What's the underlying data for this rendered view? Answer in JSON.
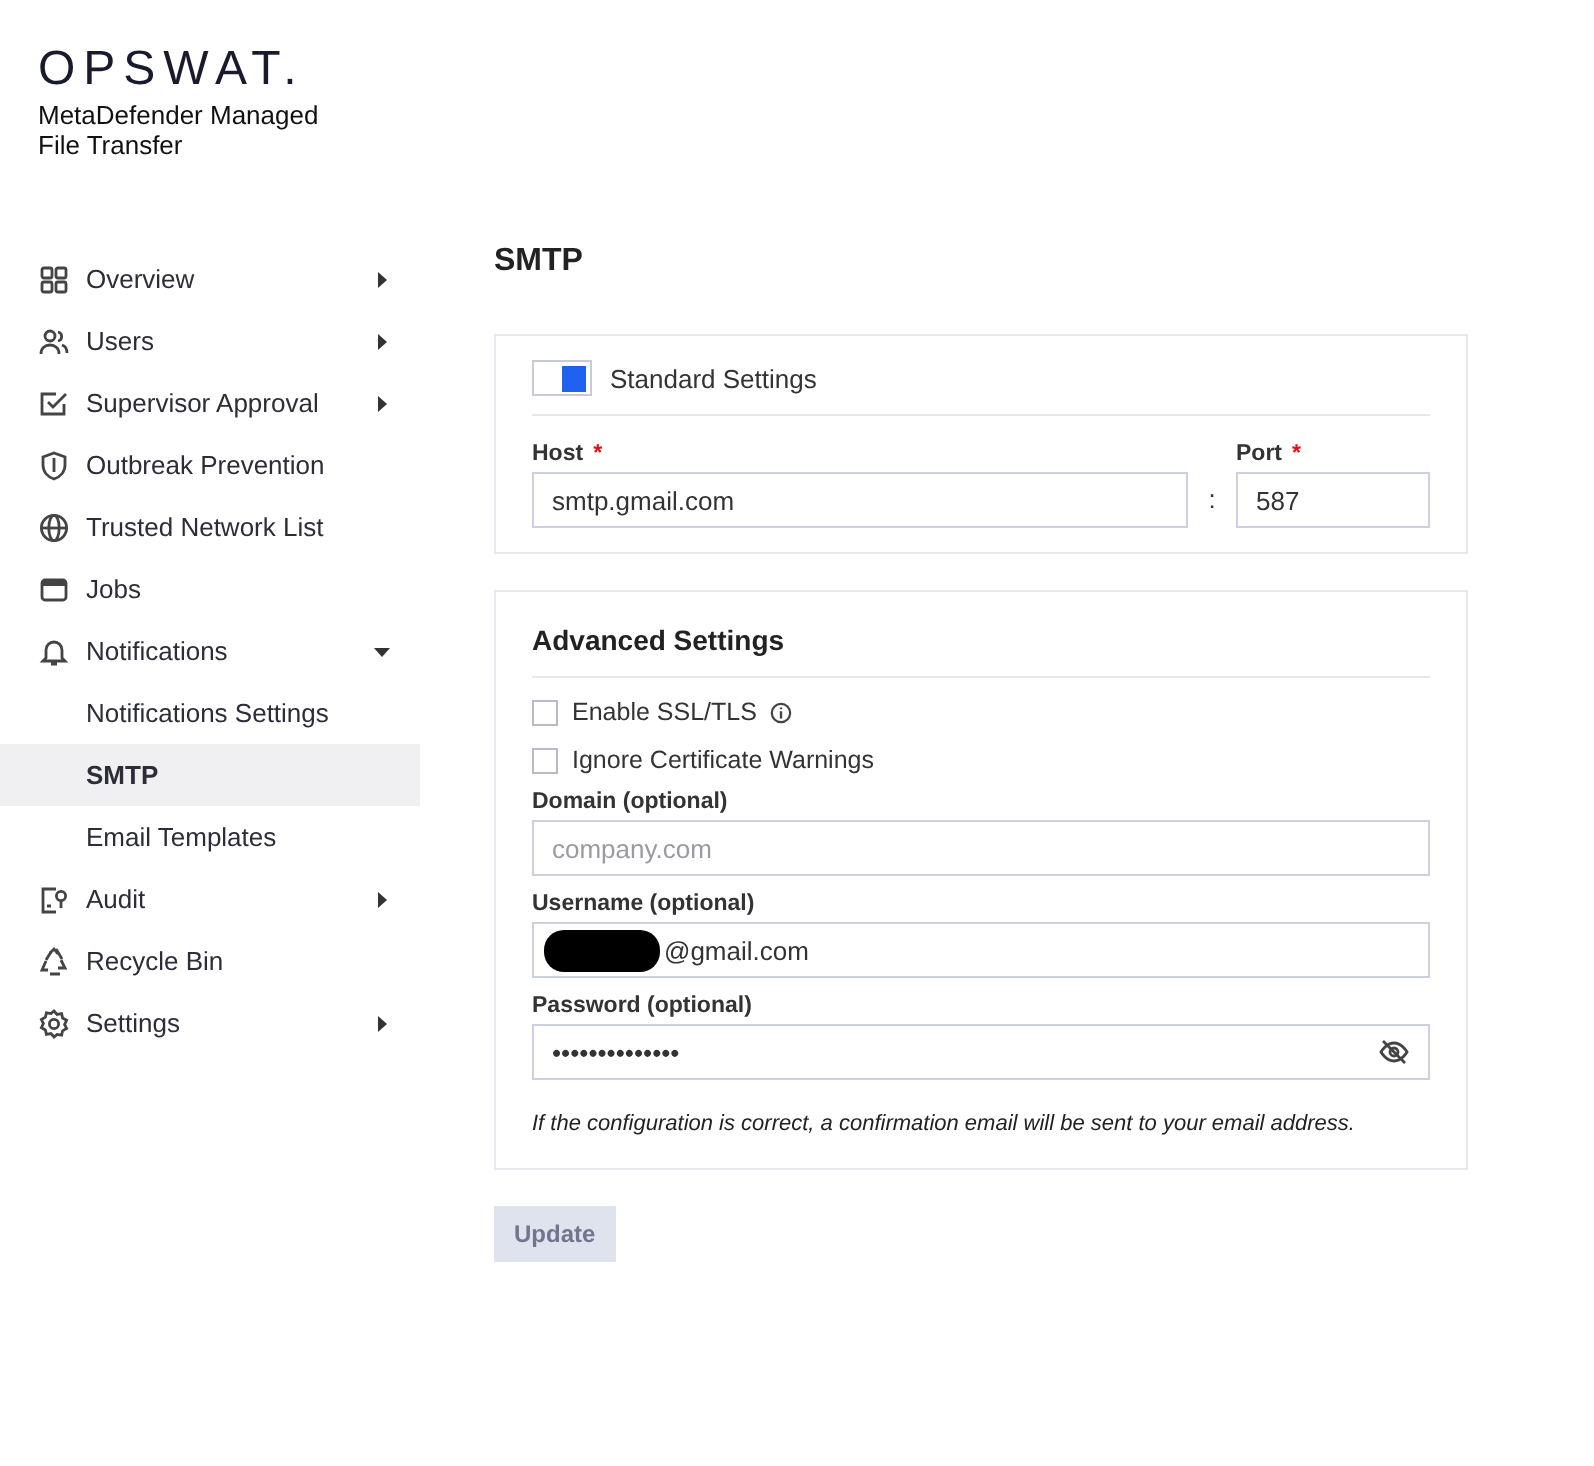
{
  "brand": {
    "logo": "OPSWAT.",
    "product": "MetaDefender Managed File Transfer"
  },
  "sidebar": {
    "items": [
      {
        "label": "Overview",
        "kind": "group",
        "expanded": false,
        "selected": false
      },
      {
        "label": "Users",
        "kind": "group",
        "expanded": false,
        "selected": false
      },
      {
        "label": "Supervisor Approval",
        "kind": "group",
        "expanded": false,
        "selected": false
      },
      {
        "label": "Outbreak Prevention",
        "kind": "link",
        "selected": false
      },
      {
        "label": "Trusted Network List",
        "kind": "link",
        "selected": false
      },
      {
        "label": "Jobs",
        "kind": "link",
        "selected": false
      },
      {
        "label": "Notifications",
        "kind": "group",
        "expanded": true,
        "selected": false,
        "children": [
          {
            "label": "Notifications Settings",
            "selected": false
          },
          {
            "label": "SMTP",
            "selected": true
          },
          {
            "label": "Email Templates",
            "selected": false
          }
        ]
      },
      {
        "label": "Audit",
        "kind": "group",
        "expanded": false,
        "selected": false
      },
      {
        "label": "Recycle Bin",
        "kind": "link",
        "selected": false
      },
      {
        "label": "Settings",
        "kind": "group",
        "expanded": false,
        "selected": false
      }
    ]
  },
  "page_title": "SMTP",
  "standard": {
    "toggle": {
      "label": "Standard Settings",
      "on": true
    },
    "host": {
      "label": "Host",
      "required_mark": "*",
      "value": "smtp.gmail.com"
    },
    "separator": ":",
    "port": {
      "label": "Port",
      "required_mark": "*",
      "value": "587"
    }
  },
  "advanced": {
    "title": "Advanced Settings",
    "checkboxes": [
      {
        "label": "Enable SSL/TLS",
        "checked": false,
        "info": true
      },
      {
        "label": "Ignore Certificate Warnings",
        "checked": false,
        "info": false
      }
    ],
    "domain": {
      "label": "Domain (optional)",
      "placeholder": "company.com"
    },
    "username": {
      "label": "Username (optional)",
      "value": "@gmail.com",
      "redacted": true
    },
    "password": {
      "label": "Password (optional)",
      "value": "••••••••••••••"
    },
    "note": "If the configuration is correct, a confirmation email will be sent to your email address."
  },
  "update_button": {
    "label": "Update",
    "disabled": true
  }
}
